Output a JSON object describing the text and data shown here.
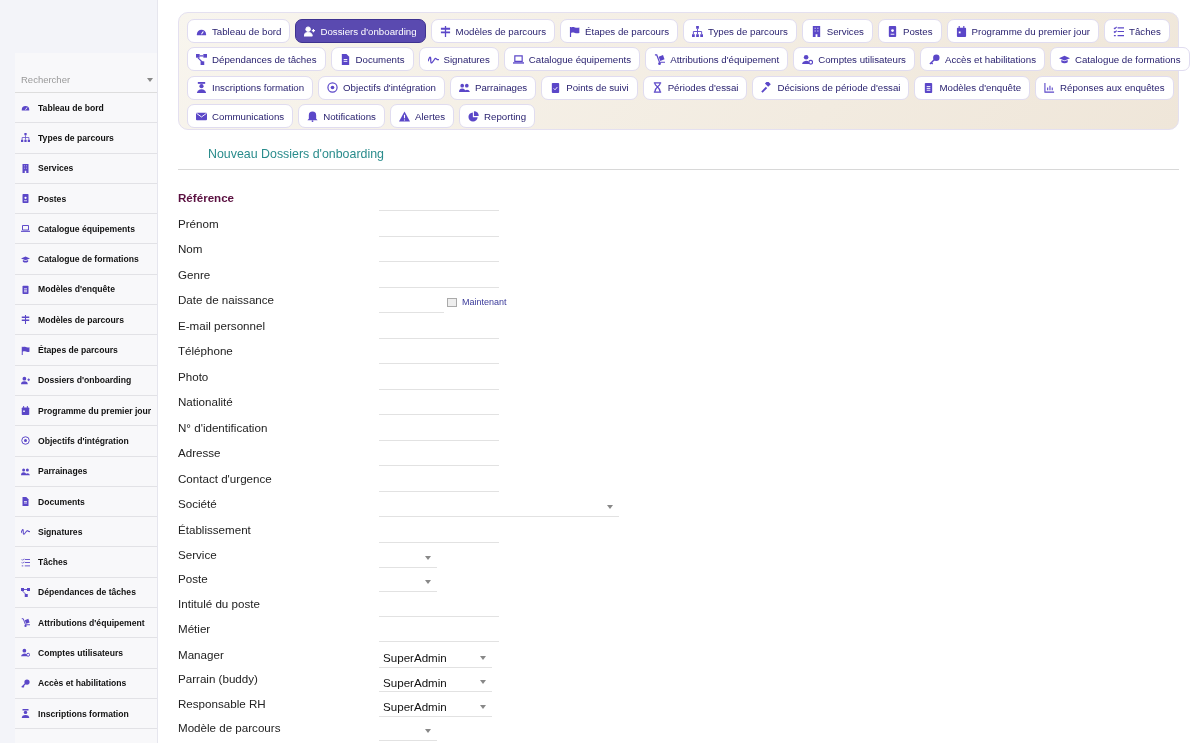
{
  "sidebar": {
    "search": {
      "placeholder": "Rechercher"
    },
    "items": [
      {
        "label": "Tableau de bord"
      },
      {
        "label": "Types de parcours"
      },
      {
        "label": "Services"
      },
      {
        "label": "Postes"
      },
      {
        "label": "Catalogue équipements"
      },
      {
        "label": "Catalogue de formations"
      },
      {
        "label": "Modèles d'enquête"
      },
      {
        "label": "Modèles de parcours"
      },
      {
        "label": "Étapes de parcours"
      },
      {
        "label": "Dossiers d'onboarding"
      },
      {
        "label": "Programme du premier jour"
      },
      {
        "label": "Objectifs d'intégration"
      },
      {
        "label": "Parrainages"
      },
      {
        "label": "Documents"
      },
      {
        "label": "Signatures"
      },
      {
        "label": "Tâches"
      },
      {
        "label": "Dépendances de tâches"
      },
      {
        "label": "Attributions d'équipement"
      },
      {
        "label": "Comptes utilisateurs"
      },
      {
        "label": "Accès et habilitations"
      },
      {
        "label": "Inscriptions formation"
      }
    ]
  },
  "tab_rows": [
    {
      "tabs": [
        {
          "label": "Tableau de bord",
          "selected": false
        },
        {
          "label": "Dossiers d'onboarding",
          "selected": true
        },
        {
          "label": "Modèles de parcours",
          "selected": false
        },
        {
          "label": "Étapes de parcours",
          "selected": false
        },
        {
          "label": "Types de parcours",
          "selected": false
        },
        {
          "label": "Services",
          "selected": false
        },
        {
          "label": "Postes",
          "selected": false
        },
        {
          "label": "Programme du premier jour",
          "selected": false
        },
        {
          "label": "Tâches",
          "selected": false
        }
      ]
    },
    {
      "tabs": [
        {
          "label": "Dépendances de tâches",
          "selected": false
        },
        {
          "label": "Documents",
          "selected": false
        },
        {
          "label": "Signatures",
          "selected": false
        },
        {
          "label": "Catalogue équipements",
          "selected": false
        },
        {
          "label": "Attributions d'équipement",
          "selected": false
        },
        {
          "label": "Comptes utilisateurs",
          "selected": false
        },
        {
          "label": "Accès et habilitations",
          "selected": false
        },
        {
          "label": "Catalogue de formations",
          "selected": false
        }
      ]
    },
    {
      "tabs": [
        {
          "label": "Inscriptions formation",
          "selected": false
        },
        {
          "label": "Objectifs d'intégration",
          "selected": false
        },
        {
          "label": "Parrainages",
          "selected": false
        },
        {
          "label": "Points de suivi",
          "selected": false
        },
        {
          "label": "Périodes d'essai",
          "selected": false
        },
        {
          "label": "Décisions de période d'essai",
          "selected": false
        },
        {
          "label": "Modèles d'enquête",
          "selected": false
        },
        {
          "label": "Réponses aux enquêtes",
          "selected": false
        }
      ]
    },
    {
      "tabs": [
        {
          "label": "Communications",
          "selected": false
        },
        {
          "label": "Notifications",
          "selected": false
        },
        {
          "label": "Alertes",
          "selected": false
        },
        {
          "label": "Reporting",
          "selected": false
        }
      ]
    }
  ],
  "form": {
    "title": "Nouveau Dossiers d'onboarding",
    "fields": [
      {
        "label": "Référence",
        "kind": "text",
        "required": true
      },
      {
        "label": "Prénom",
        "kind": "text",
        "required": false
      },
      {
        "label": "Nom",
        "kind": "text",
        "required": false
      },
      {
        "label": "Genre",
        "kind": "text",
        "required": false
      },
      {
        "label": "Date de naissance",
        "kind": "date",
        "required": false,
        "link": "Maintenant"
      },
      {
        "label": "E-mail personnel",
        "kind": "text",
        "required": false
      },
      {
        "label": "Téléphone",
        "kind": "text",
        "required": false
      },
      {
        "label": "Photo",
        "kind": "text",
        "required": false
      },
      {
        "label": "Nationalité",
        "kind": "text",
        "required": false
      },
      {
        "label": "N° d'identification",
        "kind": "text",
        "required": false
      },
      {
        "label": "Adresse",
        "kind": "text",
        "required": false
      },
      {
        "label": "Contact d'urgence",
        "kind": "text",
        "required": false
      },
      {
        "label": "Société",
        "kind": "lookup",
        "required": false
      },
      {
        "label": "Établissement",
        "kind": "text",
        "required": false
      },
      {
        "label": "Service",
        "kind": "select",
        "required": false
      },
      {
        "label": "Poste",
        "kind": "select",
        "required": false
      },
      {
        "label": "Intitulé du poste",
        "kind": "text",
        "required": false
      },
      {
        "label": "Métier",
        "kind": "text",
        "required": false
      },
      {
        "label": "Manager",
        "kind": "user",
        "required": false,
        "value": "SuperAdmin"
      },
      {
        "label": "Parrain (buddy)",
        "kind": "user",
        "required": false,
        "value": "SuperAdmin"
      },
      {
        "label": "Responsable RH",
        "kind": "user",
        "required": false,
        "value": "SuperAdmin"
      },
      {
        "label": "Modèle de parcours",
        "kind": "select",
        "required": false
      }
    ]
  }
}
